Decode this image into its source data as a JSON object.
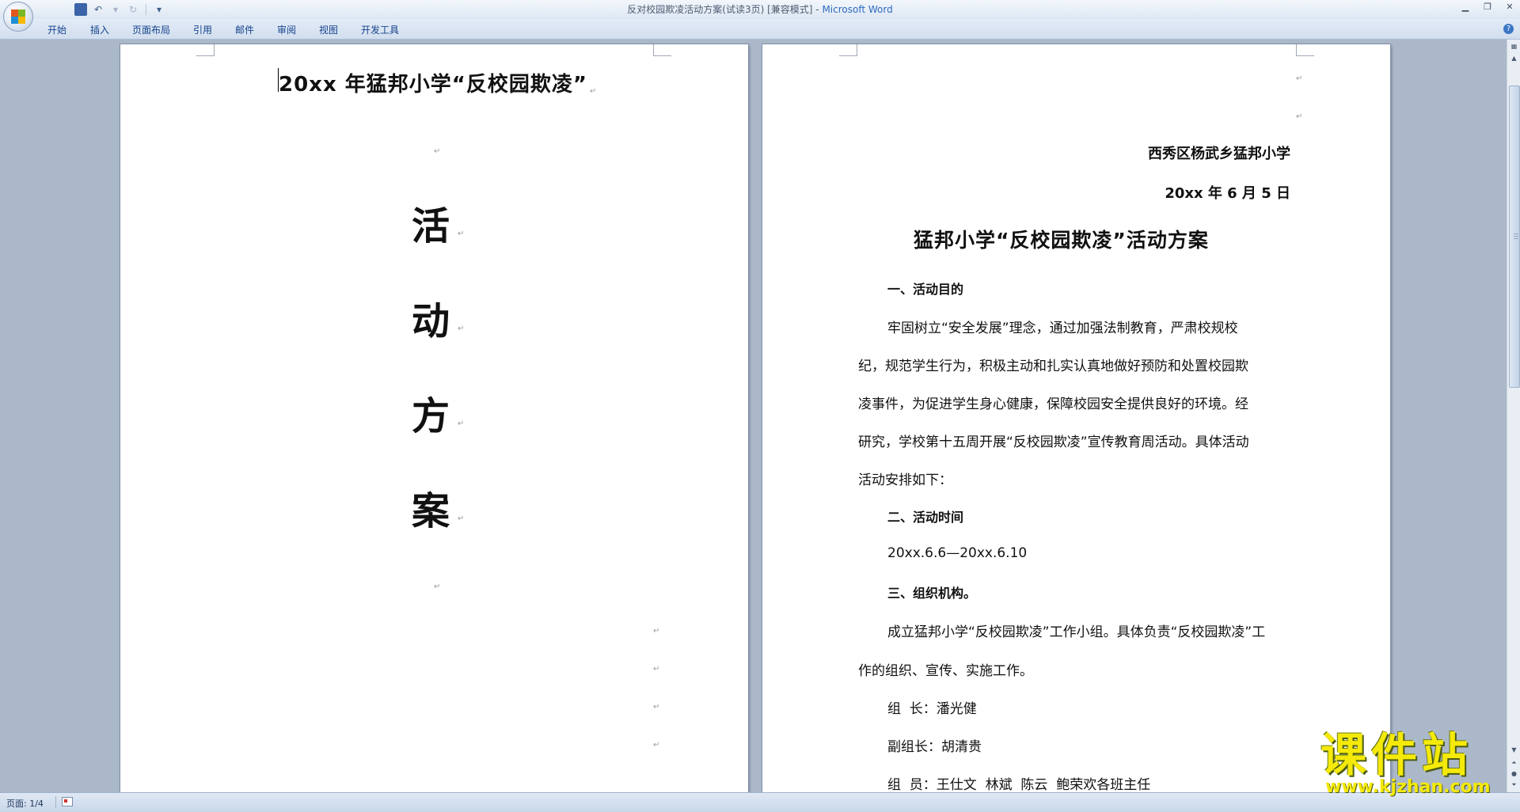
{
  "window": {
    "title": "反对校园欺凌活动方案(试读3页) [兼容模式]",
    "app_name": "Microsoft Word"
  },
  "quick_access": {
    "icons": [
      "save-icon",
      "undo-icon",
      "redo-icon",
      "customize-dropdown-icon"
    ]
  },
  "ribbon": {
    "tabs": [
      "开始",
      "插入",
      "页面布局",
      "引用",
      "邮件",
      "审阅",
      "视图",
      "开发工具"
    ]
  },
  "page1": {
    "heading": "20xx 年猛邦小学“反校园欺凌”",
    "big_chars": [
      "活",
      "动",
      "方",
      "案"
    ]
  },
  "page2": {
    "org": "西秀区杨武乡猛邦小学",
    "date": "20xx 年 6 月 5 日",
    "title": "猛邦小学“反校园欺凌”活动方案",
    "sections": [
      {
        "heading": "一、活动目的"
      },
      {
        "lines": [
          "牢固树立“安全发展”理念，通过加强法制教育，严肃校规校",
          "纪，规范学生行为，积极主动和扎实认真地做好预防和处置校园欺",
          "凌事件，为促进学生身心健康，保障校园安全提供良好的环境。经",
          "研究，学校第十五周开展“反校园欺凌”宣传教育周活动。具体活动",
          "活动安排如下："
        ]
      },
      {
        "heading": "二、活动时间"
      },
      {
        "text": "20xx.6.6—20xx.6.10"
      },
      {
        "heading": "三、组织机构。"
      },
      {
        "lines": [
          "成立猛邦小学“反校园欺凌”工作小组。具体负责“反校园欺凌”工",
          "作的组织、宣传、实施工作。"
        ]
      },
      {
        "text": "组  长：潘光健"
      },
      {
        "text": "副组长：胡清贵"
      },
      {
        "text": "组  员：王仕文  林斌  陈云  鲍荣欢各班主任"
      }
    ]
  },
  "status": {
    "page_label": "页面: 1/4"
  },
  "watermark": {
    "text": "课件站",
    "url": "www.kjzhan.com"
  }
}
